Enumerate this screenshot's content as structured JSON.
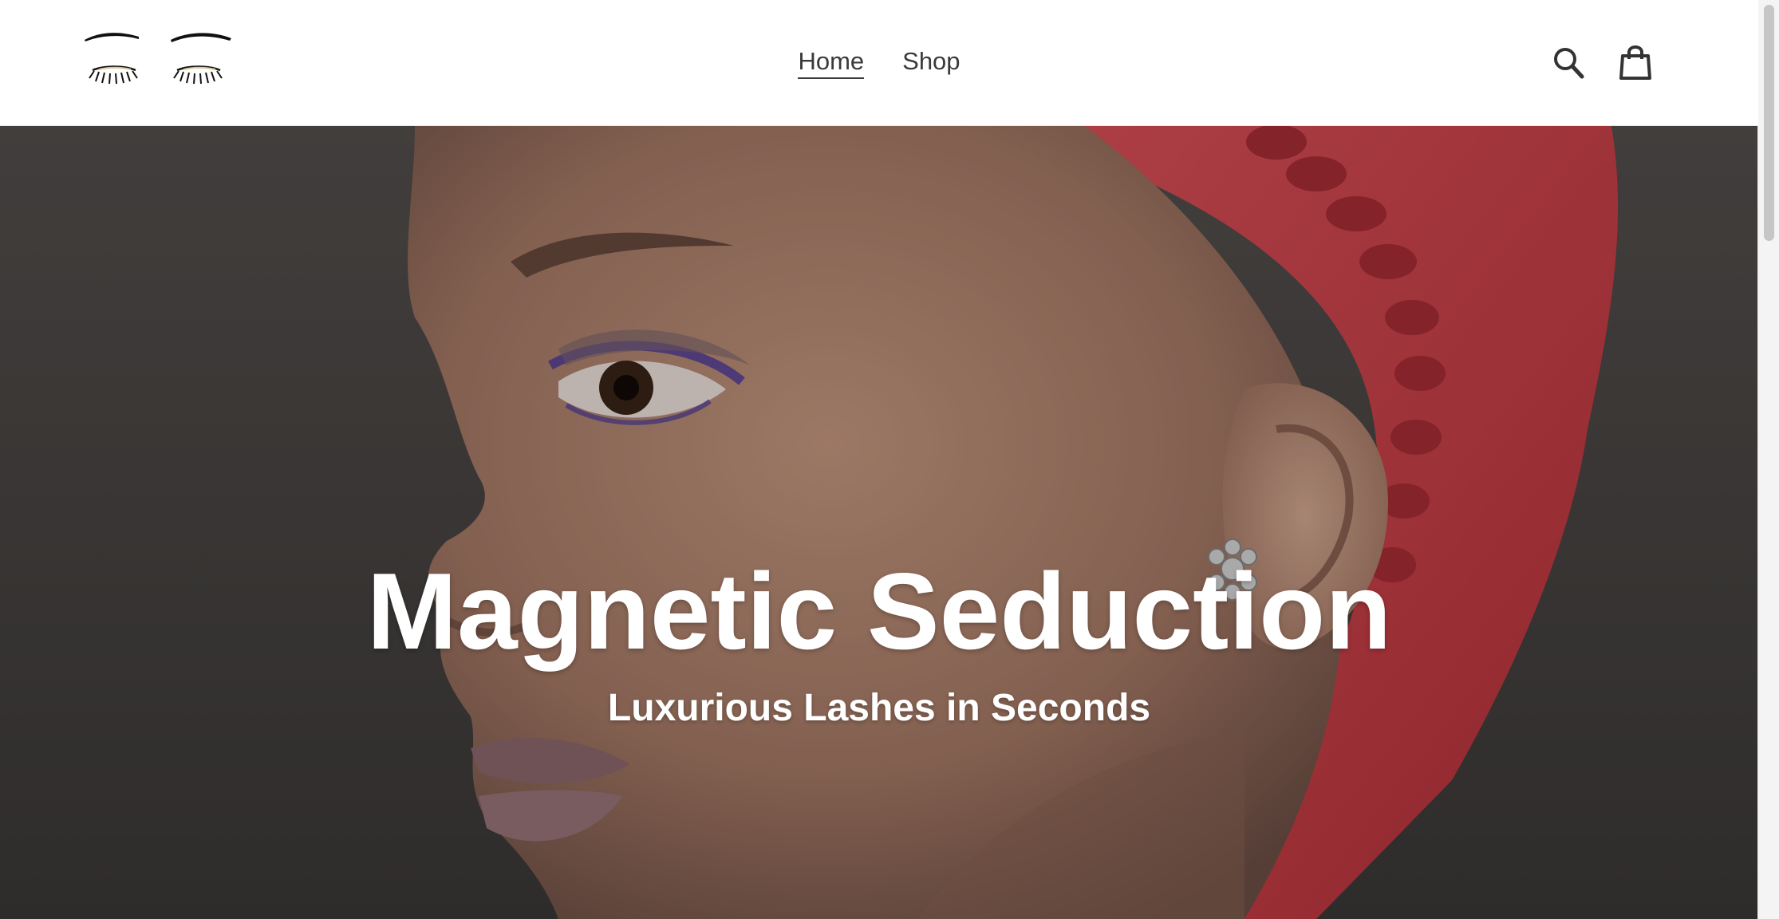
{
  "header": {
    "logo_alt": "lash logo",
    "nav": [
      {
        "label": "Home",
        "active": true
      },
      {
        "label": "Shop",
        "active": false
      }
    ],
    "icons": {
      "search": "search-icon",
      "cart": "shopping-bag-icon"
    }
  },
  "hero": {
    "title": "Magnetic Seduction",
    "subtitle": "Luxurious Lashes in Seconds"
  },
  "colors": {
    "header_bg": "#ffffff",
    "nav_text": "#3a3a3a",
    "hero_text": "#ffffff",
    "hair_accent": "#d8454d"
  }
}
